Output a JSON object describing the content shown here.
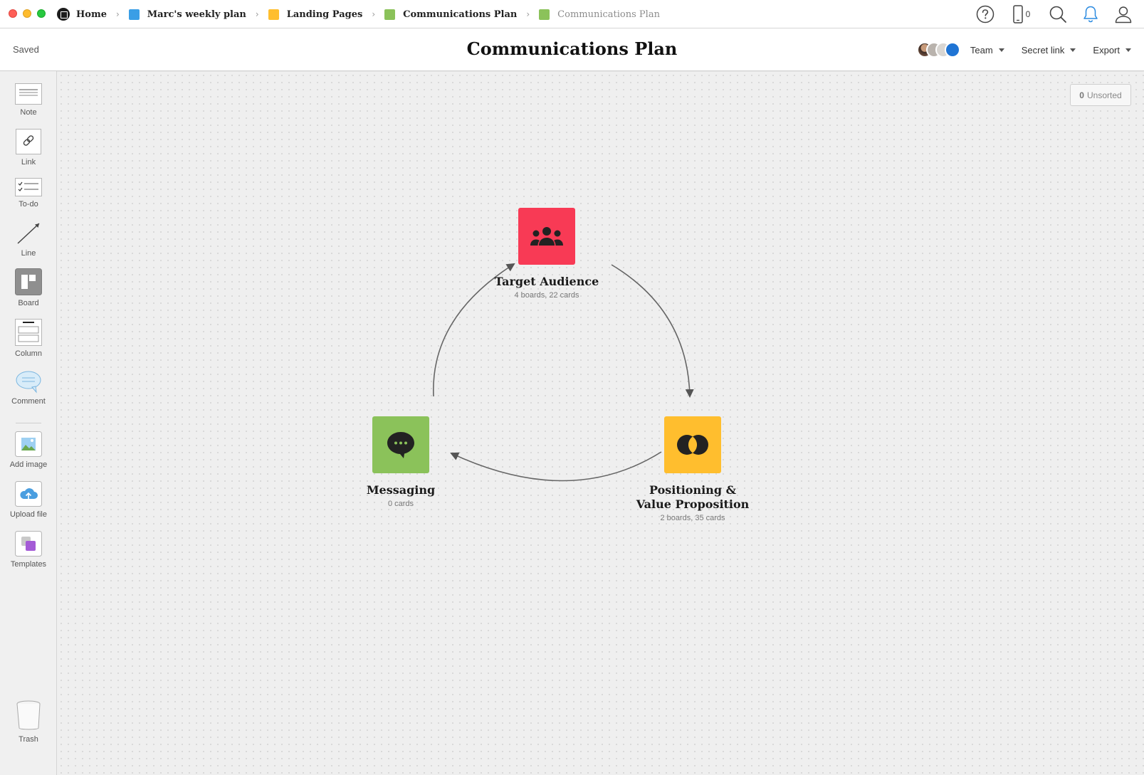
{
  "window": {
    "controls": [
      "close",
      "minimize",
      "maximize"
    ]
  },
  "breadcrumbs": [
    {
      "label": "Home",
      "color": "#1d1d1d"
    },
    {
      "label": "Marc's weekly plan",
      "color": "#3a9ee6"
    },
    {
      "label": "Landing Pages",
      "color": "#ffbe2e"
    },
    {
      "label": "Communications Plan",
      "color": "#8bc25a"
    },
    {
      "label": "Communications Plan",
      "color": "#8bc25a"
    }
  ],
  "topbar": {
    "phone_count": "0"
  },
  "header": {
    "status": "Saved",
    "title": "Communications Plan",
    "team_label": "Team",
    "share_label": "Secret link",
    "export_label": "Export"
  },
  "sidebar": {
    "tools": [
      {
        "label": "Note"
      },
      {
        "label": "Link"
      },
      {
        "label": "To-do"
      },
      {
        "label": "Line"
      },
      {
        "label": "Board"
      },
      {
        "label": "Column"
      },
      {
        "label": "Comment"
      },
      {
        "label": "Add image"
      },
      {
        "label": "Upload file"
      },
      {
        "label": "Templates"
      }
    ],
    "trash_label": "Trash"
  },
  "canvas": {
    "unsorted_count": "0",
    "unsorted_label": "Unsorted",
    "boards": [
      {
        "name": "Target Audience",
        "meta": "4 boards, 22 cards",
        "color": "#f83a55",
        "icon": "group-icon"
      },
      {
        "name": "Positioning & Value Proposition",
        "meta": "2 boards, 35 cards",
        "color": "#ffbe2e",
        "icon": "overlap-circles-icon"
      },
      {
        "name": "Messaging",
        "meta": "0 cards",
        "color": "#8bc25a",
        "icon": "chat-bubble-icon"
      }
    ]
  }
}
